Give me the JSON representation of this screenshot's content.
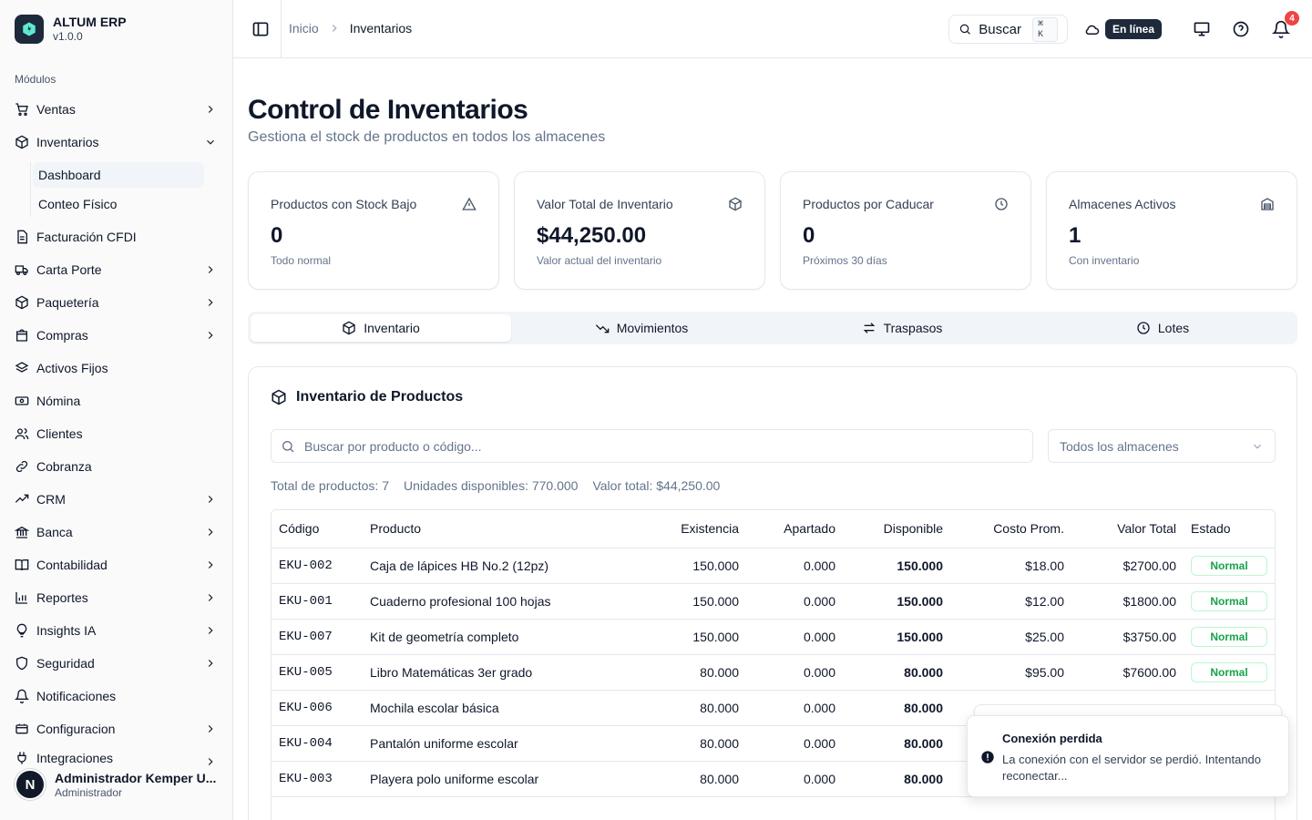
{
  "brand": {
    "name": "ALTUM ERP",
    "version": "v1.0.0"
  },
  "sidebar": {
    "section": "Módulos",
    "items": [
      {
        "label": "Ventas",
        "icon": "cart-icon",
        "chevron": true
      },
      {
        "label": "Inventarios",
        "icon": "box-icon",
        "expanded": true
      },
      {
        "label": "Facturación CFDI",
        "icon": "file-icon",
        "chevron": false
      },
      {
        "label": "Carta Porte",
        "icon": "truck-icon",
        "chevron": true
      },
      {
        "label": "Paquetería",
        "icon": "package-icon",
        "chevron": true
      },
      {
        "label": "Compras",
        "icon": "shopping-bag-icon",
        "chevron": true
      },
      {
        "label": "Activos Fijos",
        "icon": "layers-icon",
        "chevron": false
      },
      {
        "label": "Nómina",
        "icon": "banknote-icon",
        "chevron": false
      },
      {
        "label": "Clientes",
        "icon": "users-icon",
        "chevron": false
      },
      {
        "label": "Cobranza",
        "icon": "link-icon",
        "chevron": false
      },
      {
        "label": "CRM",
        "icon": "trending-icon",
        "chevron": true
      },
      {
        "label": "Banca",
        "icon": "bank-icon",
        "chevron": true
      },
      {
        "label": "Contabilidad",
        "icon": "book-icon",
        "chevron": true
      },
      {
        "label": "Reportes",
        "icon": "bar-chart-icon",
        "chevron": true
      },
      {
        "label": "Insights IA",
        "icon": "lightbulb-icon",
        "chevron": true
      },
      {
        "label": "Seguridad",
        "icon": "shield-icon",
        "chevron": true
      },
      {
        "label": "Notificaciones",
        "icon": "bell-icon",
        "chevron": false
      },
      {
        "label": "Configuracion",
        "icon": "gear-icon",
        "chevron": true
      },
      {
        "label": "Integraciones",
        "icon": "plug-icon",
        "chevron": true
      }
    ],
    "subitems": [
      "Dashboard",
      "Conteo Físico"
    ],
    "user": {
      "initial": "N",
      "name": "Administrador Kemper U...",
      "role": "Administrador"
    }
  },
  "header": {
    "breadcrumb": [
      "Inicio",
      "Inventarios"
    ],
    "search_label": "Buscar",
    "shortcut": "⌘ K",
    "status": "En línea",
    "notifications": "4"
  },
  "page": {
    "title": "Control de Inventarios",
    "subtitle": "Gestiona el stock de productos en todos los almacenes"
  },
  "cards": [
    {
      "title": "Productos con Stock Bajo",
      "value": "0",
      "sub": "Todo normal",
      "icon": "alert-triangle-icon"
    },
    {
      "title": "Valor Total de Inventario",
      "value": "$44,250.00",
      "sub": "Valor actual del inventario",
      "icon": "box-icon"
    },
    {
      "title": "Productos por Caducar",
      "value": "0",
      "sub": "Próximos 30 días",
      "icon": "clock-icon"
    },
    {
      "title": "Almacenes Activos",
      "value": "1",
      "sub": "Con inventario",
      "icon": "warehouse-icon"
    }
  ],
  "tabs": [
    "Inventario",
    "Movimientos",
    "Traspasos",
    "Lotes"
  ],
  "panel": {
    "title": "Inventario de Productos",
    "search_placeholder": "Buscar por producto o código...",
    "warehouse_select": "Todos los almacenes",
    "stats": {
      "total_label": "Total de productos:",
      "total": "7",
      "units_label": "Unidades disponibles:",
      "units": "770.000",
      "value_label": "Valor total:",
      "value": "$44,250.00"
    },
    "columns": [
      "Código",
      "Producto",
      "Existencia",
      "Apartado",
      "Disponible",
      "Costo Prom.",
      "Valor Total",
      "Estado"
    ],
    "rows": [
      [
        "EKU-002",
        "Caja de lápices HB No.2 (12pz)",
        "150.000",
        "0.000",
        "150.000",
        "$18.00",
        "$2700.00",
        "Normal"
      ],
      [
        "EKU-001",
        "Cuaderno profesional 100 hojas",
        "150.000",
        "0.000",
        "150.000",
        "$12.00",
        "$1800.00",
        "Normal"
      ],
      [
        "EKU-007",
        "Kit de geometría completo",
        "150.000",
        "0.000",
        "150.000",
        "$25.00",
        "$3750.00",
        "Normal"
      ],
      [
        "EKU-005",
        "Libro Matemáticas 3er grado",
        "80.000",
        "0.000",
        "80.000",
        "$95.00",
        "$7600.00",
        "Normal"
      ],
      [
        "EKU-006",
        "Mochila escolar básica",
        "80.000",
        "0.000",
        "80.000",
        "",
        "",
        ""
      ],
      [
        "EKU-004",
        "Pantalón uniforme escolar",
        "80.000",
        "0.000",
        "80.000",
        "",
        "",
        ""
      ],
      [
        "EKU-003",
        "Playera polo uniforme escolar",
        "80.000",
        "0.000",
        "80.000",
        "",
        "",
        ""
      ]
    ]
  },
  "toast": {
    "title": "Conexión perdida",
    "message": "La conexión con el servidor se perdió. Intentando reconectar..."
  },
  "colors": {
    "accent": "#1e293b",
    "danger": "#ef4444",
    "success": "#16a34a"
  }
}
